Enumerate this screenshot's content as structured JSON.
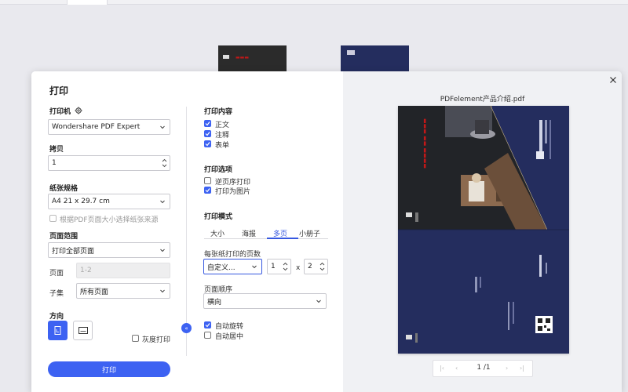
{
  "dialog": {
    "title": "打印",
    "printer": {
      "label": "打印机",
      "value": "Wondershare PDF Expert"
    },
    "copies": {
      "label": "拷贝",
      "value": "1"
    },
    "paper": {
      "label": "纸张规格",
      "value": "A4 21 x 29.7 cm",
      "auto_source_label": "根据PDF页面大小选择纸张来源"
    },
    "page_range": {
      "label": "页面范围",
      "value": "打印全部页面",
      "pages_label": "页面",
      "pages_placeholder": "1-2",
      "subset_label": "子集",
      "subset_value": "所有页面"
    },
    "orientation": {
      "label": "方向"
    },
    "grayscale_label": "灰度打印",
    "print_button": "打印",
    "content": {
      "label": "打印内容",
      "items": [
        {
          "label": "正文",
          "checked": true
        },
        {
          "label": "注释",
          "checked": true
        },
        {
          "label": "表单",
          "checked": true
        }
      ]
    },
    "options": {
      "label": "打印选项",
      "items": [
        {
          "label": "逆页序打印",
          "checked": false
        },
        {
          "label": "打印为图片",
          "checked": true
        }
      ]
    },
    "mode": {
      "label": "打印模式",
      "tabs": [
        "大小",
        "海报",
        "多页",
        "小册子"
      ],
      "active_tab": "多页",
      "per_sheet_label": "每张纸打印的页数",
      "per_sheet_value": "自定义...",
      "cols": "1",
      "times": "x",
      "rows": "2",
      "order_label": "页面顺序",
      "order_value": "横向",
      "auto_rotate_label": "自动旋转",
      "auto_center_label": "自动居中"
    }
  },
  "preview": {
    "filename": "PDFelement产品介绍.pdf",
    "page_indicator": "1 /1"
  },
  "colors": {
    "accent": "#3d62f2",
    "preview_bg": "#242d5e"
  }
}
